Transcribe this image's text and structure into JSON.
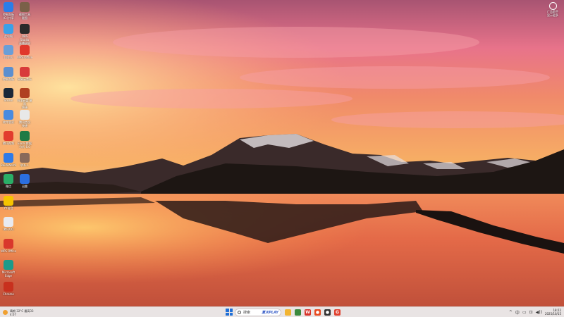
{
  "desktop": {
    "icons_left": [
      {
        "label": "控制面板\n(C:)共享",
        "icon": "control-panel-icon",
        "color": "#2b7de9"
      },
      {
        "label": "此电脑",
        "icon": "this-pc-icon",
        "color": "#3aa0e8"
      },
      {
        "label": "回收站",
        "icon": "recycle-bin-icon",
        "color": "#6a9ed8"
      },
      {
        "label": "控制面板",
        "icon": "settings-icon",
        "color": "#5b8fd0"
      },
      {
        "label": "Steam",
        "icon": "steam-icon",
        "color": "#1b2838"
      },
      {
        "label": "软件管家",
        "icon": "app-manager-icon",
        "color": "#4a8be0"
      },
      {
        "label": "腾讯视频",
        "icon": "video-icon",
        "color": "#e23c2e"
      },
      {
        "label": "BaiduNetdisk",
        "icon": "baidu-netdisk-icon",
        "color": "#2f7be8"
      },
      {
        "label": "微信",
        "icon": "wechat-icon",
        "color": "#2aae67"
      },
      {
        "label": "YY语音",
        "icon": "yy-icon",
        "color": "#f5c400"
      },
      {
        "label": "腾讯QQ",
        "icon": "qq-icon",
        "color": "#e8eaf0"
      },
      {
        "label": "WPS Office",
        "icon": "wps-icon",
        "color": "#d9382c"
      },
      {
        "label": "Microsoft Edge",
        "icon": "edge-icon",
        "color": "#1e9a8a"
      },
      {
        "label": "Chrome",
        "icon": "chrome-icon",
        "color": "#c8301e"
      }
    ],
    "icons_col2": [
      {
        "label": "截图工具\n截图",
        "icon": "snapshot-icon",
        "color": "#7a6048"
      },
      {
        "label": "OBS Studio\n直播录屏",
        "icon": "obs-icon",
        "color": "#2a2a2a"
      },
      {
        "label": "WPS Office",
        "icon": "wps-2-icon",
        "color": "#e0382c"
      },
      {
        "label": "网易云音乐",
        "icon": "music-icon",
        "color": "#d83a3a"
      },
      {
        "label": "阿里云盘 桌面\n快捷",
        "icon": "game-icon",
        "color": "#b04020"
      },
      {
        "label": "腾讯会议\n快捷",
        "icon": "doc-icon",
        "color": "#e8e8e8"
      },
      {
        "label": "Excel 数据\n分析 6.0",
        "icon": "excel-icon",
        "color": "#1f7a45"
      },
      {
        "label": "联系人",
        "icon": "contact-icon",
        "color": "#8a6a5a"
      },
      {
        "label": "迅雷",
        "icon": "thunder-icon",
        "color": "#2b6fe0"
      }
    ],
    "corner_widget": {
      "icon": "ai-assistant-icon",
      "label": "广告助手\n显示更多"
    }
  },
  "taskbar": {
    "weather": {
      "icon": "sun-icon",
      "line1": "晴朗 32°C 最高33",
      "line2": "4:07"
    },
    "start_icon": "windows-start-icon",
    "search": {
      "placeholder": "搜索",
      "promo": "夏天PLAY"
    },
    "apps": [
      {
        "name": "file-explorer-icon",
        "color": "#f2b430",
        "glyph": ""
      },
      {
        "name": "chrome-taskbar-icon",
        "color": "#3b8a3e",
        "glyph": ""
      },
      {
        "name": "wps-taskbar-icon",
        "color": "#d8332a",
        "glyph": "W"
      },
      {
        "name": "app-taskbar-icon",
        "color": "#e84a20",
        "glyph": "●"
      },
      {
        "name": "obs-taskbar-icon",
        "color": "#333333",
        "glyph": "●"
      },
      {
        "name": "google-taskbar-icon",
        "color": "#e0402e",
        "glyph": "G"
      }
    ],
    "tray": {
      "icons": [
        "^",
        "中",
        "▭",
        "⊡",
        "◀))"
      ],
      "time": "18:22",
      "date": "2025/10/15"
    }
  }
}
